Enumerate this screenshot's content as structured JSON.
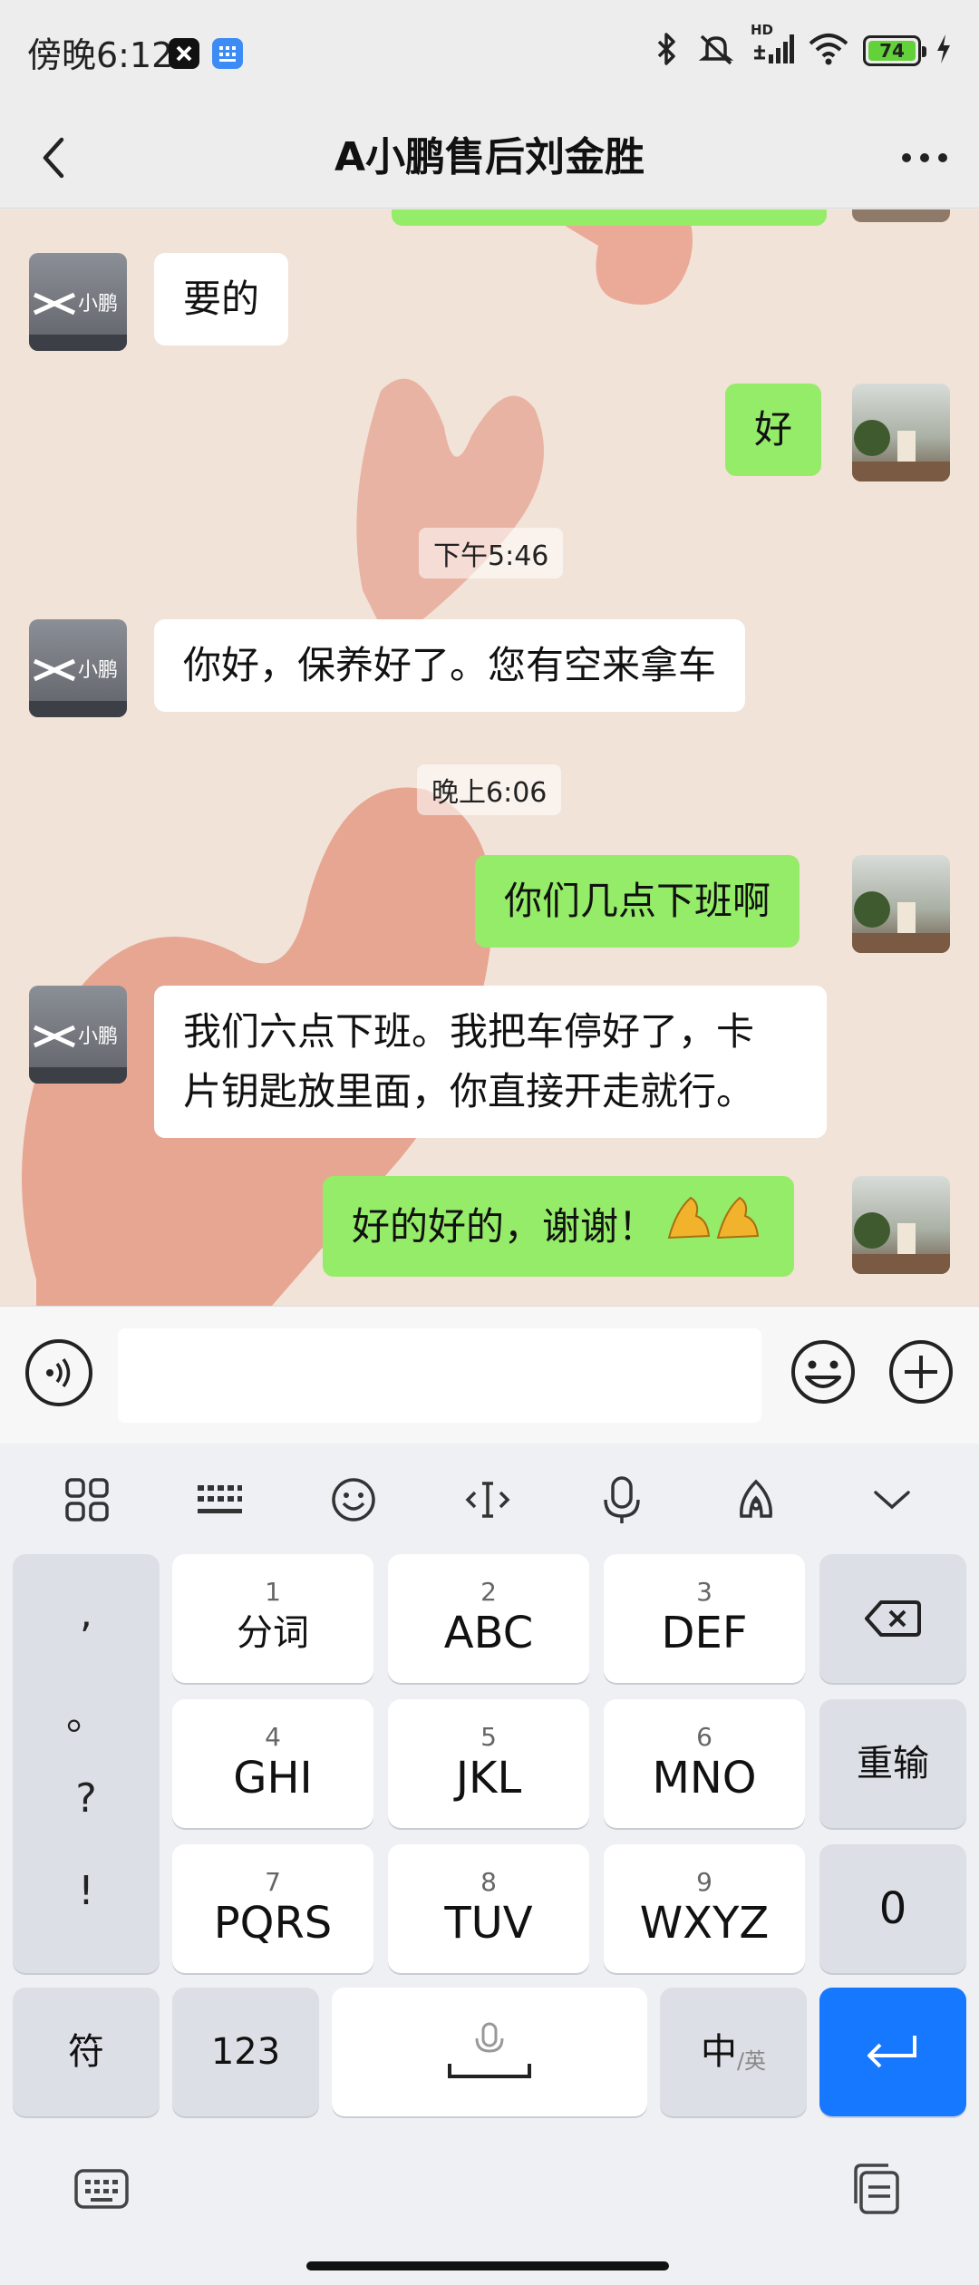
{
  "status_bar": {
    "time": "傍晚6:12",
    "battery": "74",
    "network": "HD"
  },
  "header": {
    "title": "A小鹏售后刘金胜"
  },
  "messages": [
    {
      "side": "in",
      "text": "要的"
    },
    {
      "side": "out",
      "text": "好"
    },
    {
      "type": "time",
      "text": "下午5:46"
    },
    {
      "side": "in",
      "text": "你好，保养好了。您有空来拿车"
    },
    {
      "type": "time",
      "text": "晚上6:06"
    },
    {
      "side": "out",
      "text": "你们几点下班啊"
    },
    {
      "side": "in",
      "line1": "我们六点下班。我把车停好了，卡",
      "line2": "片钥匙放里面，你直接开走就行。"
    },
    {
      "side": "out",
      "text": "好的好的，谢谢！"
    }
  ],
  "contact_avatar_text": "小鹏",
  "input": {
    "placeholder": ""
  },
  "keyboard": {
    "punctuation": [
      ",",
      "。",
      "?",
      "!"
    ],
    "keys": [
      {
        "num": "1",
        "label": "分词"
      },
      {
        "num": "2",
        "label": "ABC"
      },
      {
        "num": "3",
        "label": "DEF"
      },
      {
        "num": "4",
        "label": "GHI"
      },
      {
        "num": "5",
        "label": "JKL"
      },
      {
        "num": "6",
        "label": "MNO"
      },
      {
        "num": "7",
        "label": "PQRS"
      },
      {
        "num": "8",
        "label": "TUV"
      },
      {
        "num": "9",
        "label": "WXYZ"
      }
    ],
    "reinput_label": "重输",
    "zero_label": "0",
    "symbol_label": "符",
    "numeric_label": "123",
    "lang_main": "中",
    "lang_sub": "/英"
  }
}
